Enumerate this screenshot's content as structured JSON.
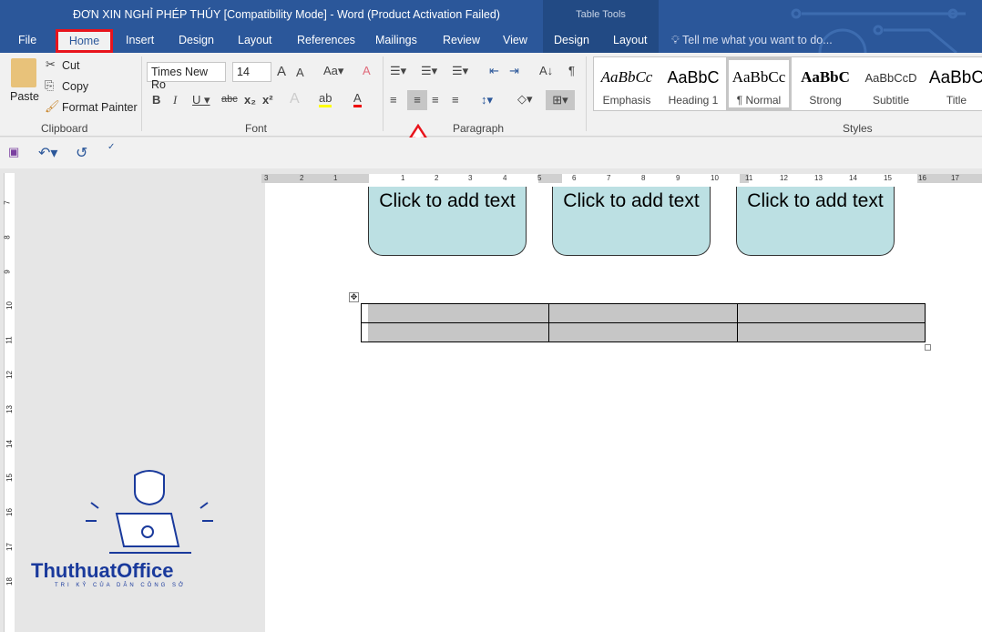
{
  "window": {
    "title": "ĐƠN XIN NGHỈ PHÉP THÚY [Compatibility Mode] - Word (Product Activation Failed)",
    "context_group": "Table Tools"
  },
  "tabs": [
    "File",
    "Home",
    "Insert",
    "Design",
    "Layout",
    "References",
    "Mailings",
    "Review",
    "View",
    "Design",
    "Layout"
  ],
  "active_tab": "Home",
  "tell_me": "Tell me what you want to do...",
  "clipboard": {
    "paste": "Paste",
    "cut": "Cut",
    "copy": "Copy",
    "format_painter": "Format Painter",
    "label": "Clipboard"
  },
  "font": {
    "name": "Times New Ro",
    "size": "14",
    "label": "Font"
  },
  "paragraph": {
    "label": "Paragraph",
    "selected_alignment": "center"
  },
  "styles": {
    "label": "Styles",
    "items": [
      {
        "preview": "AaBbCc",
        "name": "Emphasis"
      },
      {
        "preview": "AaBbC",
        "name": "Heading 1"
      },
      {
        "preview": "AaBbCc",
        "name": "¶ Normal",
        "selected": true
      },
      {
        "preview": "AaBbC",
        "name": "Strong"
      },
      {
        "preview": "AaBbCcD",
        "name": "Subtitle"
      },
      {
        "preview": "AaBbC",
        "name": "Title"
      }
    ]
  },
  "ruler": {
    "h_ticks": [
      "3",
      "2",
      "1",
      "1",
      "2",
      "3",
      "4",
      "5",
      "6",
      "7",
      "8",
      "9",
      "10",
      "11",
      "12",
      "13",
      "14",
      "15",
      "16",
      "17"
    ],
    "v_ticks": [
      "7",
      "8",
      "9",
      "10",
      "11",
      "12",
      "13",
      "14",
      "15",
      "16",
      "17",
      "18"
    ]
  },
  "document": {
    "shapes": [
      "Click to add text",
      "Click to add text",
      "Click to add text"
    ],
    "table": {
      "rows": 2,
      "cols": 3
    }
  },
  "logo": {
    "name": "ThuthuatOffice",
    "tagline": "TRI KỶ CỦA DÂN CÔNG SỞ"
  },
  "colors": {
    "title_bar": "#2b579a",
    "highlight_box": "#e8141c",
    "shape_fill": "#bce0e3",
    "table_shading": "#c6c6c6"
  }
}
